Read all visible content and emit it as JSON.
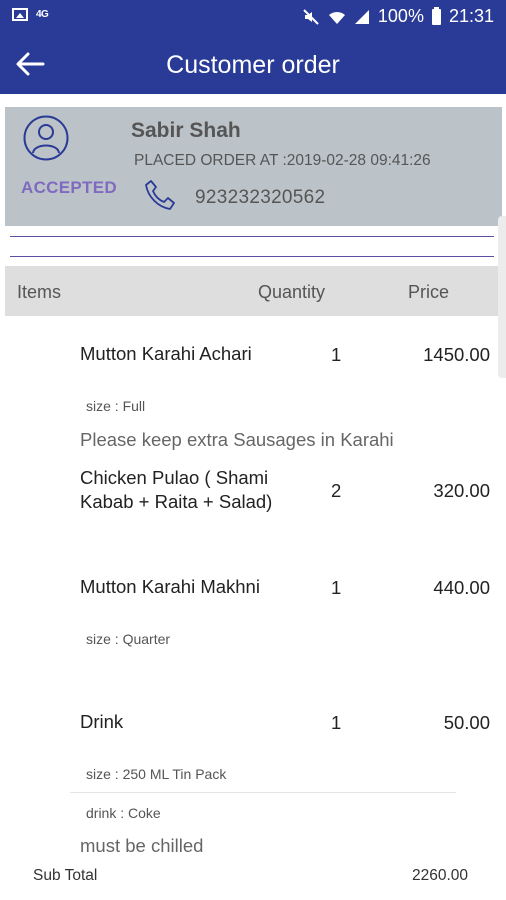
{
  "status_bar": {
    "network_label": "4G",
    "battery": "100%",
    "time": "21:31"
  },
  "toolbar": {
    "title": "Customer order"
  },
  "customer": {
    "name": "Sabir Shah",
    "placed_order": "PLACED ORDER AT :2019-02-28 09:41:26",
    "phone": "923232320562",
    "status": "ACCEPTED"
  },
  "table_headers": {
    "items": "Items",
    "quantity": "Quantity",
    "price": "Price"
  },
  "items": [
    {
      "name": "Mutton Karahi Achari",
      "qty": "1",
      "price": "1450.00",
      "options": [
        "size : Full"
      ],
      "note": "Please keep extra Sausages in Karahi"
    },
    {
      "name_line1": "Chicken Pulao ( Shami",
      "name_line2": "Kabab + Raita + Salad)",
      "qty": "2",
      "price": "320.00"
    },
    {
      "name": "Mutton Karahi Makhni",
      "qty": "1",
      "price": "440.00",
      "options": [
        "size : Quarter"
      ]
    },
    {
      "name": "Drink",
      "qty": "1",
      "price": "50.00",
      "options": [
        "size : 250 ML Tin Pack",
        "drink : Coke"
      ],
      "note": "must be chilled"
    }
  ],
  "subtotal": {
    "label": "Sub Total",
    "value": "2260.00"
  },
  "colors": {
    "primary": "#2a3b97",
    "card_bg": "#bcc3c8",
    "accent": "#7f6ac1"
  }
}
